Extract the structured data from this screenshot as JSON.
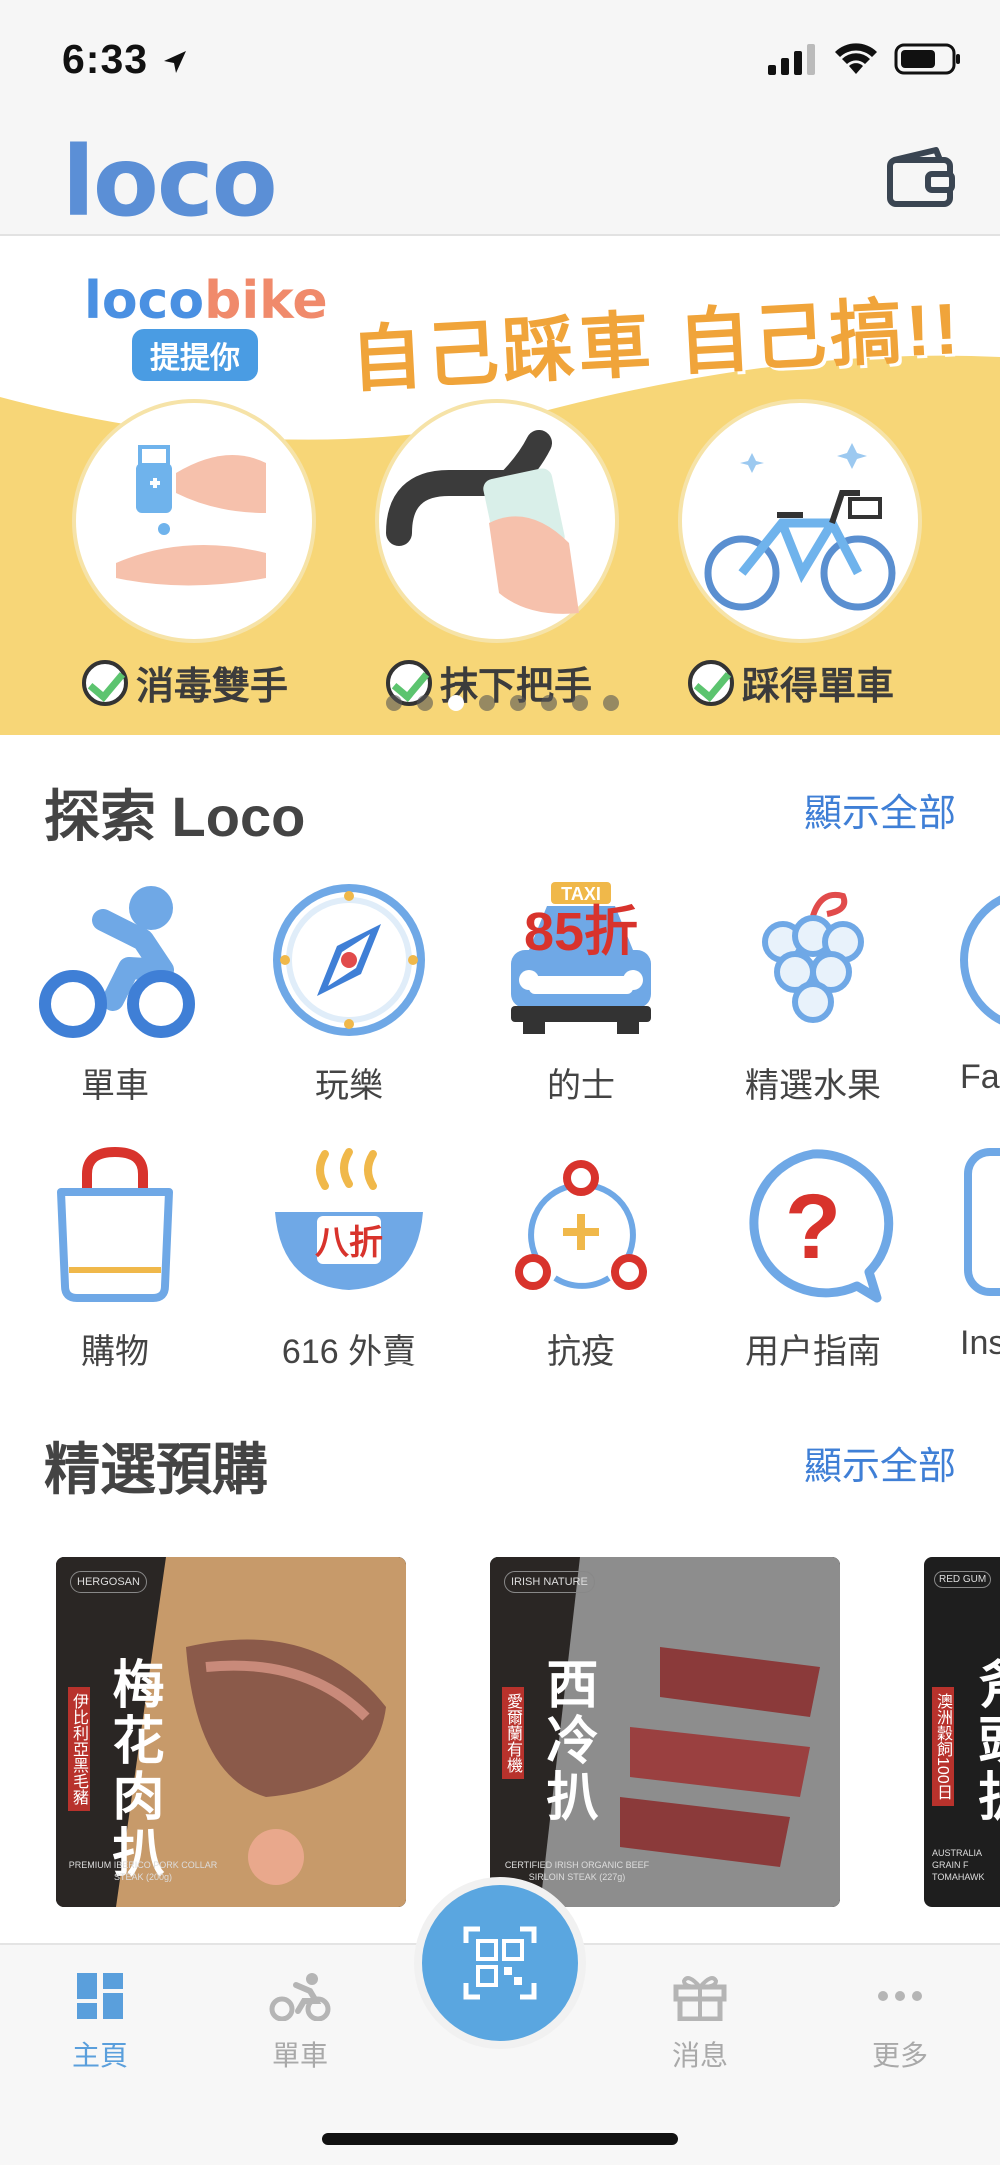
{
  "status_bar": {
    "time": "6:33"
  },
  "header": {
    "logo": "loco",
    "wallet_icon": "wallet-icon"
  },
  "banner": {
    "brand_part1": "loco",
    "brand_part2": "bike",
    "tag": "提提你",
    "headline": "自己踩車 自己搞!!",
    "steps": [
      "消毒雙手",
      "抹下把手",
      "踩得單車"
    ],
    "page_count": 8,
    "active_page": 3
  },
  "explore": {
    "title": "探索 Loco",
    "show_all": "顯示全部",
    "items": [
      {
        "label": "單車",
        "icon": "bike-rider-icon"
      },
      {
        "label": "玩樂",
        "icon": "compass-icon"
      },
      {
        "label": "的士",
        "icon": "taxi-icon",
        "badge": "85折",
        "badge_top": "TAXI"
      },
      {
        "label": "精選水果",
        "icon": "grapes-icon"
      },
      {
        "label": "Fa",
        "icon": "partial-icon"
      },
      {
        "label": "購物",
        "icon": "shopping-bag-icon"
      },
      {
        "label": "616 外賣",
        "icon": "takeaway-bowl-icon",
        "badge": "八折"
      },
      {
        "label": "抗疫",
        "icon": "antiepidemic-icon"
      },
      {
        "label": "用户指南",
        "icon": "question-bubble-icon"
      },
      {
        "label": "Ins",
        "icon": "partial-icon"
      }
    ]
  },
  "preorder": {
    "title": "精選預購",
    "show_all": "顯示全部",
    "cards": [
      {
        "name": "梅花肉扒",
        "side": "伊比利亞黑毛豬",
        "brand": "HERGOSAN",
        "sub": "PREMIUM IBERICO PORK COLLAR STEAK (200g)"
      },
      {
        "name": "西冷扒",
        "side": "愛爾蘭有機",
        "brand": "IRISH NATURE",
        "sub": "CERTIFIED IRISH ORGANIC BEEF SIRLOIN STEAK (227g)"
      },
      {
        "name": "斧頭扒",
        "side": "澳洲穀飼100日",
        "brand": "RED GUM",
        "sub": "AUSTRALIA GRAIN F TOMAHAWK"
      }
    ]
  },
  "tab_bar": {
    "tabs": [
      {
        "label": "主頁",
        "icon": "home-grid-icon",
        "active": true
      },
      {
        "label": "單車",
        "icon": "bike-icon",
        "active": false
      },
      {
        "label": "消息",
        "icon": "gift-icon",
        "active": false
      },
      {
        "label": "更多",
        "icon": "more-dots-icon",
        "active": false
      }
    ],
    "scan_icon": "qr-scan-icon"
  },
  "colors": {
    "accent": "#5a9fdc",
    "link": "#3f7fd6",
    "banner_yellow": "#f7d677",
    "logo": "#5b8fd6"
  }
}
